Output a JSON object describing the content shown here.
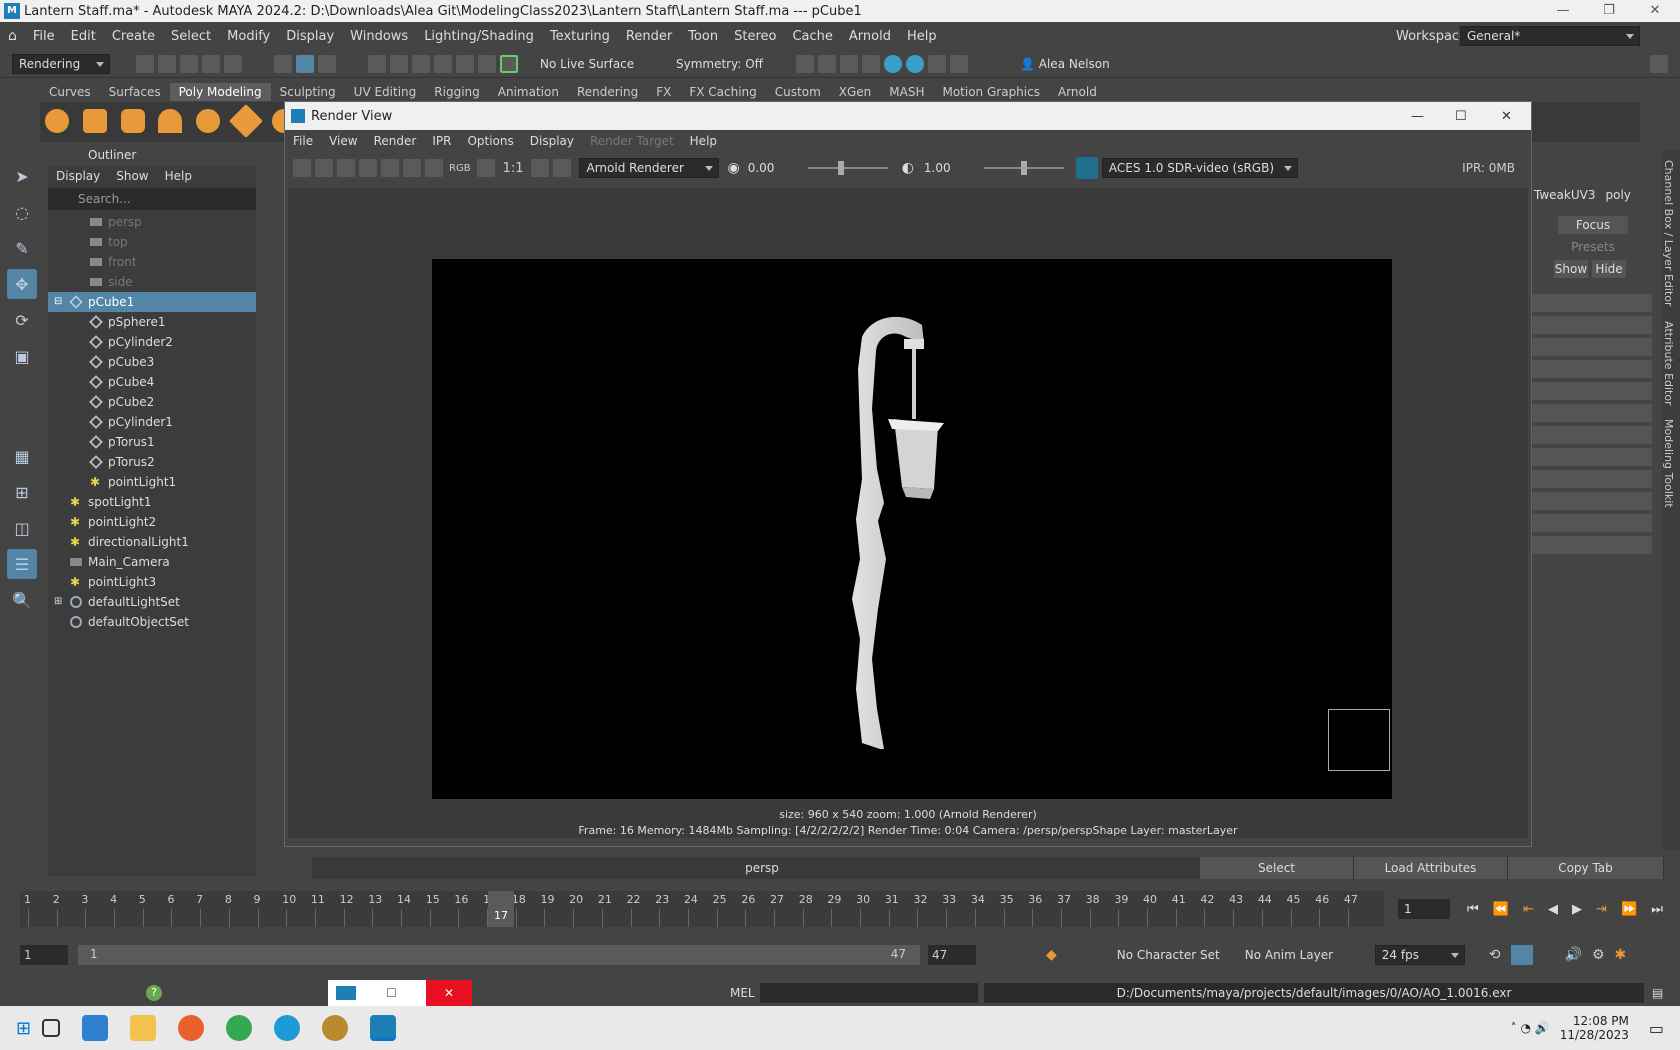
{
  "window": {
    "title": "Lantern Staff.ma* - Autodesk MAYA 2024.2: D:\\Downloads\\Alea Git\\ModelingClass2023\\Lantern Staff\\Lantern Staff.ma   ---   pCube1",
    "logo": "M"
  },
  "menubar": {
    "items": [
      "File",
      "Edit",
      "Create",
      "Select",
      "Modify",
      "Display",
      "Windows",
      "Lighting/Shading",
      "Texturing",
      "Render",
      "Toon",
      "Stereo",
      "Cache",
      "Arnold",
      "Help"
    ],
    "workspace_label": "Workspace:",
    "workspace_value": "General*"
  },
  "statusline": {
    "menuset": "Rendering",
    "live_surface": "No Live Surface",
    "symmetry": "Symmetry: Off",
    "user": "Alea Nelson"
  },
  "shelf": {
    "tabs": [
      "Curves",
      "Surfaces",
      "Poly Modeling",
      "Sculpting",
      "UV Editing",
      "Rigging",
      "Animation",
      "Rendering",
      "FX",
      "FX Caching",
      "Custom",
      "XGen",
      "MASH",
      "Motion Graphics",
      "Arnold"
    ],
    "active_tab": "Poly Modeling"
  },
  "outliner": {
    "title": "Outliner",
    "menu": [
      "Display",
      "Show",
      "Help"
    ],
    "search_placeholder": "Search...",
    "items": [
      {
        "label": "persp",
        "indent": 1,
        "dim": true,
        "icon": "camera-icon"
      },
      {
        "label": "top",
        "indent": 1,
        "dim": true,
        "icon": "camera-icon"
      },
      {
        "label": "front",
        "indent": 1,
        "dim": true,
        "icon": "camera-icon"
      },
      {
        "label": "side",
        "indent": 1,
        "dim": true,
        "icon": "camera-icon"
      },
      {
        "label": "pCube1",
        "indent": 0,
        "selected": true,
        "icon": "mesh-icon",
        "expander": "-"
      },
      {
        "label": "pSphere1",
        "indent": 1,
        "icon": "mesh-icon"
      },
      {
        "label": "pCylinder2",
        "indent": 1,
        "icon": "mesh-icon"
      },
      {
        "label": "pCube3",
        "indent": 1,
        "icon": "mesh-icon"
      },
      {
        "label": "pCube4",
        "indent": 1,
        "icon": "mesh-icon"
      },
      {
        "label": "pCube2",
        "indent": 1,
        "icon": "mesh-icon"
      },
      {
        "label": "pCylinder1",
        "indent": 1,
        "icon": "mesh-icon"
      },
      {
        "label": "pTorus1",
        "indent": 1,
        "icon": "mesh-icon"
      },
      {
        "label": "pTorus2",
        "indent": 1,
        "icon": "mesh-icon"
      },
      {
        "label": "pointLight1",
        "indent": 1,
        "icon": "light-icon"
      },
      {
        "label": "spotLight1",
        "indent": 0,
        "icon": "light-icon"
      },
      {
        "label": "pointLight2",
        "indent": 0,
        "icon": "light-icon"
      },
      {
        "label": "directionalLight1",
        "indent": 0,
        "icon": "light-icon"
      },
      {
        "label": "Main_Camera",
        "indent": 0,
        "icon": "camera-icon"
      },
      {
        "label": "pointLight3",
        "indent": 0,
        "icon": "light-icon"
      },
      {
        "label": "defaultLightSet",
        "indent": 0,
        "icon": "set-icon",
        "expander": "+"
      },
      {
        "label": "defaultObjectSet",
        "indent": 0,
        "icon": "set-icon"
      }
    ]
  },
  "render_view": {
    "title": "Render View",
    "menu": [
      "File",
      "View",
      "Render",
      "IPR",
      "Options",
      "Display",
      "Render Target",
      "Help"
    ],
    "disabled_menu": "Render Target",
    "ratio": "1:1",
    "rgb": "RGB",
    "renderer": "Arnold Renderer",
    "exposure": "0.00",
    "gamma": "1.00",
    "color_space": "ACES 1.0 SDR-video (sRGB)",
    "ipr": "IPR: 0MB",
    "info_line1": "size: 960 x 540 zoom: 1.000     (Arnold Renderer)",
    "info_line2": "Frame: 16    Memory: 1484Mb    Sampling: [4/2/2/2/2/2]    Render Time: 0:04    Camera: /persp/perspShape    Layer: masterLayer"
  },
  "right_panel": {
    "tab1": "TweakUV3",
    "tab2": "poly",
    "focus": "Focus",
    "presets": "Presets",
    "show": "Show",
    "hide": "Hide",
    "side_tabs": [
      "Channel Box / Layer Editor",
      "Attribute Editor",
      "Modeling Toolkit"
    ]
  },
  "viewport_label": "persp",
  "attr_buttons": [
    "Select",
    "Load Attributes",
    "Copy Tab"
  ],
  "timeline": {
    "ticks": [
      "1",
      "2",
      "3",
      "4",
      "5",
      "6",
      "7",
      "8",
      "9",
      "10",
      "11",
      "12",
      "13",
      "14",
      "15",
      "16",
      "17",
      "18",
      "19",
      "20",
      "21",
      "22",
      "23",
      "24",
      "25",
      "26",
      "27",
      "28",
      "29",
      "30",
      "31",
      "32",
      "33",
      "34",
      "35",
      "36",
      "37",
      "38",
      "39",
      "40",
      "41",
      "42",
      "43",
      "44",
      "45",
      "46",
      "47"
    ],
    "current_frame": "17",
    "current_frame_field": "1"
  },
  "range": {
    "start": "1",
    "inner_start": "1",
    "inner_end": "47",
    "end": "47",
    "character_set": "No Character Set",
    "anim_layer": "No Anim Layer",
    "fps": "24 fps"
  },
  "commandline": {
    "lang": "MEL",
    "result": "D:/Documents/maya/projects/default/images/0/AO/AO_1.0016.exr"
  },
  "taskbar": {
    "time": "12:08 PM",
    "date": "11/28/2023"
  },
  "colors": {
    "selection": "#5285a6",
    "accent_orange": "#e89a3a",
    "close_red": "#e81123"
  }
}
